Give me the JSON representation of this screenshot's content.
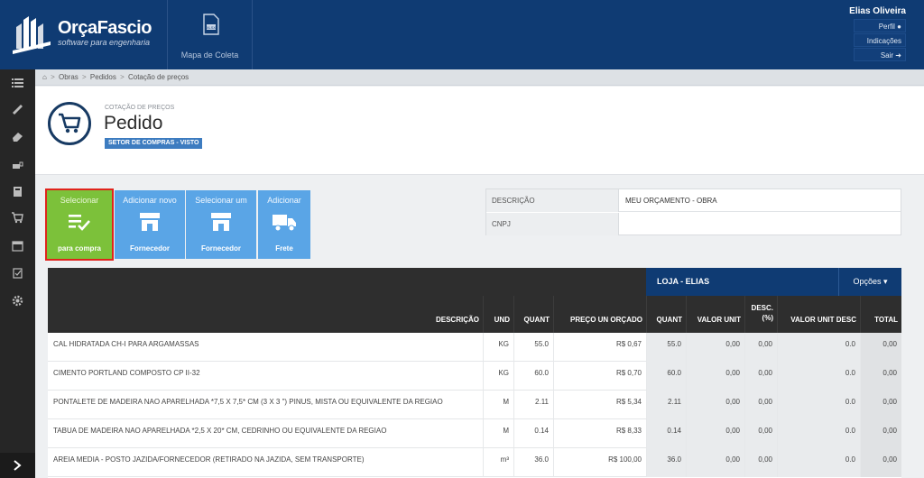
{
  "brand": {
    "name": "OrçaFascio",
    "tagline": "software para engenharia"
  },
  "nav": {
    "tile_label": "Mapa de Coleta",
    "tile_icon": "spreadsheet-icon"
  },
  "user": {
    "name": "Elias Oliveira",
    "menu": [
      "Perfil",
      "Indicações",
      "Sair"
    ]
  },
  "breadcrumb": [
    "Obras",
    "Pedidos",
    "Cotação de preços"
  ],
  "page": {
    "kicker": "COTAÇÃO DE PREÇOS",
    "title": "Pedido",
    "badge": "SETOR DE COMPRAS - VISTO"
  },
  "actions": [
    {
      "top": "Selecionar",
      "bottom": "para compra",
      "icon": "checklist-icon"
    },
    {
      "top": "Adicionar novo",
      "bottom": "Fornecedor",
      "icon": "store-icon"
    },
    {
      "top": "Selecionar um",
      "bottom": "Fornecedor",
      "icon": "store-icon"
    },
    {
      "top": "Adicionar",
      "bottom": "Frete",
      "icon": "truck-icon"
    }
  ],
  "info": [
    {
      "key": "DESCRIÇÃO",
      "value": "MEU ORÇAMENTO - OBRA"
    },
    {
      "key": "CNPJ",
      "value": ""
    }
  ],
  "grid": {
    "store": "LOJA - ELIAS",
    "options": "Opções",
    "headers": {
      "descricao": "DESCRIÇÃO",
      "und": "UND",
      "quant": "QUANT",
      "preco": "PREÇO UN ORÇADO",
      "quant2": "QUANT",
      "valor_unit": "VALOR UNIT",
      "desc_pct": "DESC. (%)",
      "valor_unit_desc": "VALOR UNIT DESC",
      "total": "TOTAL"
    },
    "rows": [
      {
        "desc": "CAL HIDRATADA CH-I PARA ARGAMASSAS",
        "und": "KG",
        "quant": "55.0",
        "preco": "R$ 0,67",
        "q2": "55.0",
        "vu": "0,00",
        "dp": "0,00",
        "vud": "0.0",
        "total": "0,00"
      },
      {
        "desc": "CIMENTO PORTLAND COMPOSTO CP II-32",
        "und": "KG",
        "quant": "60.0",
        "preco": "R$ 0,70",
        "q2": "60.0",
        "vu": "0,00",
        "dp": "0,00",
        "vud": "0.0",
        "total": "0,00"
      },
      {
        "desc": "PONTALETE DE MADEIRA NAO APARELHADA *7,5 X 7,5* CM (3 X 3 \") PINUS, MISTA OU EQUIVALENTE DA REGIAO",
        "und": "M",
        "quant": "2.11",
        "preco": "R$ 5,34",
        "q2": "2.11",
        "vu": "0,00",
        "dp": "0,00",
        "vud": "0.0",
        "total": "0,00"
      },
      {
        "desc": "TABUA DE MADEIRA NAO APARELHADA *2,5 X 20* CM, CEDRINHO OU EQUIVALENTE DA REGIAO",
        "und": "M",
        "quant": "0.14",
        "preco": "R$ 8,33",
        "q2": "0.14",
        "vu": "0,00",
        "dp": "0,00",
        "vud": "0.0",
        "total": "0,00"
      },
      {
        "desc": "AREIA MEDIA - POSTO JAZIDA/FORNECEDOR (RETIRADO NA JAZIDA, SEM TRANSPORTE)",
        "und": "m³",
        "quant": "36.0",
        "preco": "R$ 100,00",
        "q2": "36.0",
        "vu": "0,00",
        "dp": "0,00",
        "vud": "0.0",
        "total": "0,00"
      }
    ]
  },
  "colors": {
    "header": "#0f3b73",
    "sidebar": "#262626",
    "action_green": "#7cc13a",
    "action_blue": "#5aa5e6",
    "highlight": "#e0241c"
  }
}
